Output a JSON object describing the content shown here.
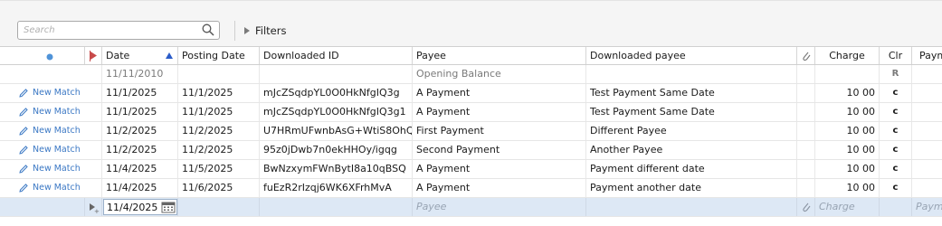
{
  "toolbar": {
    "search_placeholder": "Search",
    "filters_label": "Filters"
  },
  "columns": {
    "date": "Date",
    "posting_date": "Posting Date",
    "downloaded_id": "Downloaded ID",
    "payee": "Payee",
    "downloaded_payee": "Downloaded payee",
    "charge": "Charge",
    "clr": "Clr",
    "payment": "Payment"
  },
  "opening_row": {
    "date": "11/11/2010",
    "payee": "Opening Balance",
    "clr": "R"
  },
  "rows": [
    {
      "action": "New Match",
      "date": "11/1/2025",
      "posting_date": "11/1/2025",
      "downloaded_id": "mJcZSqdpYL0O0HkNfgIQ3g",
      "payee": "A Payment",
      "downloaded_payee": "Test Payment Same Date",
      "charge": "10 00",
      "clr": "c"
    },
    {
      "action": "New Match",
      "date": "11/1/2025",
      "posting_date": "11/1/2025",
      "downloaded_id": "mJcZSqdpYL0O0HkNfgIQ3g1",
      "payee": "A Payment",
      "downloaded_payee": "Test Payment Same Date",
      "charge": "10 00",
      "clr": "c"
    },
    {
      "action": "New Match",
      "date": "11/2/2025",
      "posting_date": "11/2/2025",
      "downloaded_id": "U7HRmUFwnbAsG+WtiS8OhQ",
      "payee": "First Payment",
      "downloaded_payee": "Different Payee",
      "charge": "10 00",
      "clr": "c"
    },
    {
      "action": "New Match",
      "date": "11/2/2025",
      "posting_date": "11/2/2025",
      "downloaded_id": "95z0jDwb7n0ekHHOy/igqg",
      "payee": "Second Payment",
      "downloaded_payee": "Another Payee",
      "charge": "10 00",
      "clr": "c"
    },
    {
      "action": "New Match",
      "date": "11/4/2025",
      "posting_date": "11/5/2025",
      "downloaded_id": "BwNzxymFWnBytI8a10qBSQ",
      "payee": "A Payment",
      "downloaded_payee": "Payment different date",
      "charge": "10 00",
      "clr": "c"
    },
    {
      "action": "New Match",
      "date": "11/4/2025",
      "posting_date": "11/6/2025",
      "downloaded_id": "fuEzR2rIzqj6WK6XFrhMvA",
      "payee": "A Payment",
      "downloaded_payee": "Payment another date",
      "charge": "10 00",
      "clr": "c"
    }
  ],
  "new_row": {
    "date": "11/4/2025",
    "payee_placeholder": "Payee",
    "charge_placeholder": "Charge",
    "payment_placeholder": "Payment"
  },
  "colors": {
    "accent_blue": "#3b78c4",
    "new_row_bg": "#dde8f5",
    "sort_arrow": "#2a5cc8",
    "flag": "#c84a4a"
  }
}
